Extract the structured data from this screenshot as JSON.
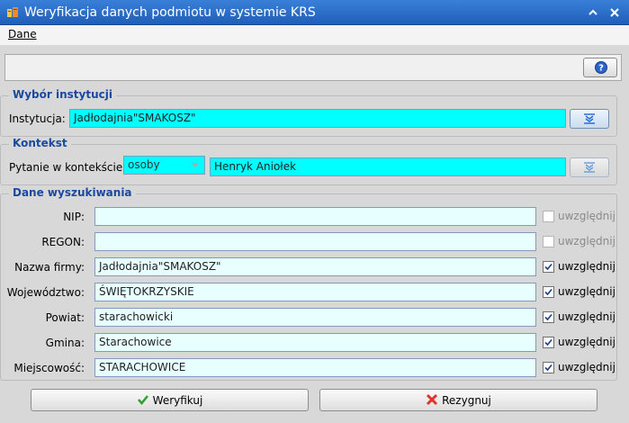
{
  "window": {
    "title": "Weryfikacja danych podmiotu w systemie KRS"
  },
  "menu": {
    "items": [
      {
        "label": "Dane"
      }
    ]
  },
  "toolbar": {
    "help_icon": "help-icon"
  },
  "sections": {
    "institution": {
      "legend": "Wybór instytucji",
      "label": "Instytucja:",
      "value": "Jadłodajnia\"SMAKOSZ\""
    },
    "context": {
      "legend": "Kontekst",
      "label": "Pytanie w kontekście:",
      "combo_value": "osoby",
      "value": "Henryk Aniołek"
    },
    "search": {
      "legend": "Dane wyszukiwania",
      "fields": [
        {
          "label": "NIP:",
          "value": "",
          "checked": false,
          "enabled": false,
          "check_label": "uwzględnij"
        },
        {
          "label": "REGON:",
          "value": "",
          "checked": false,
          "enabled": false,
          "check_label": "uwzględnij"
        },
        {
          "label": "Nazwa firmy:",
          "value": "Jadłodajnia\"SMAKOSZ\"",
          "checked": true,
          "enabled": true,
          "check_label": "uwzględnij"
        },
        {
          "label": "Województwo:",
          "value": "ŚWIĘTOKRZYSKIE",
          "checked": true,
          "enabled": true,
          "check_label": "uwzględnij"
        },
        {
          "label": "Powiat:",
          "value": "starachowicki",
          "checked": true,
          "enabled": true,
          "check_label": "uwzględnij"
        },
        {
          "label": "Gmina:",
          "value": "Starachowice",
          "checked": true,
          "enabled": true,
          "check_label": "uwzględnij"
        },
        {
          "label": "Miejscowość:",
          "value": "STARACHOWICE",
          "checked": true,
          "enabled": true,
          "check_label": "uwzględnij"
        }
      ]
    }
  },
  "buttons": {
    "verify": "Weryfikuj",
    "cancel": "Rezygnuj"
  },
  "colors": {
    "title_bar": "#1f5fb8",
    "legend_text": "#1b49a0",
    "field_active": "#00ffff",
    "field_light": "#e8ffff"
  }
}
